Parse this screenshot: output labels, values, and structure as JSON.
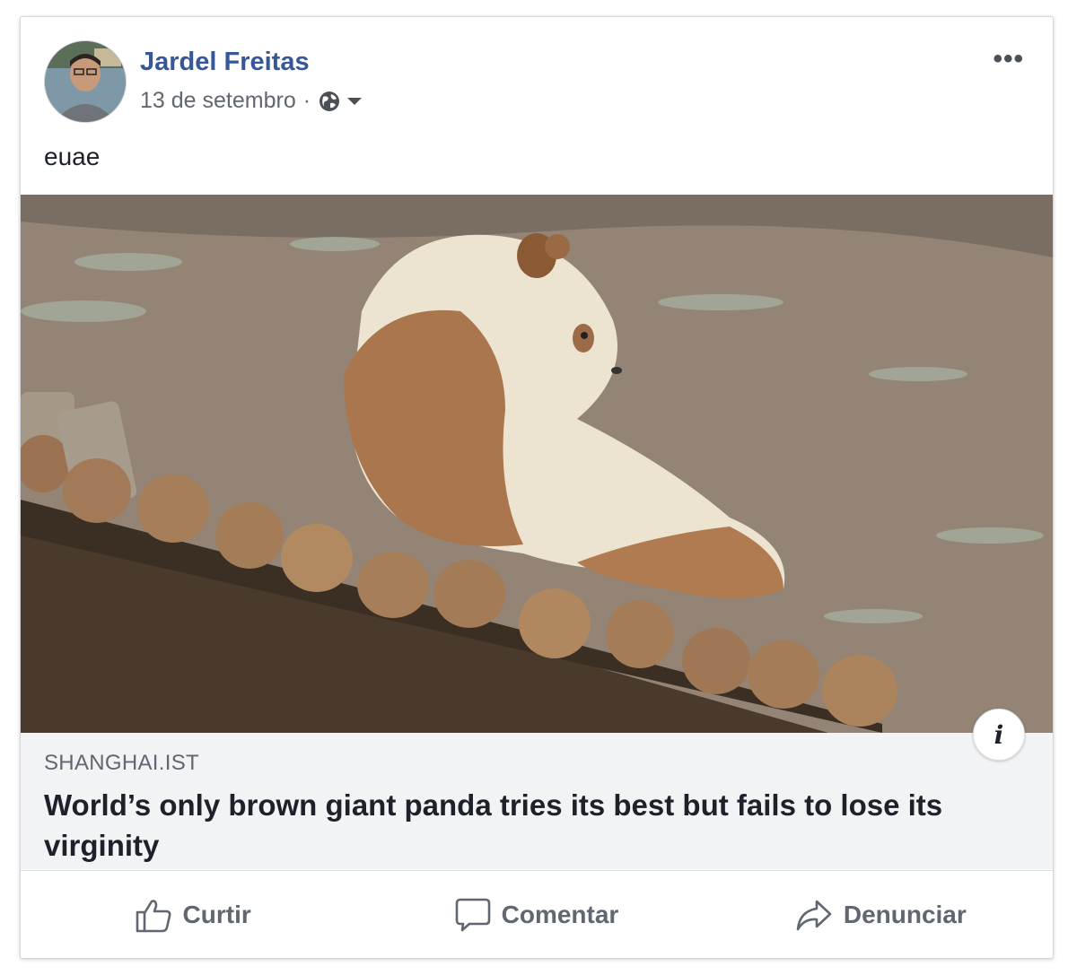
{
  "post": {
    "author": "Jardel Freitas",
    "date": "13 de setembro",
    "separator": "·",
    "privacy_icon": "globe-icon",
    "more_label": "•••",
    "text": "euae"
  },
  "link": {
    "source": "SHANGHAI.IST",
    "headline": "World’s only brown giant panda tries its best but fails to lose its virginity",
    "info_label": "i"
  },
  "actions": [
    {
      "label": "Curtir",
      "icon": "thumbs-up-icon"
    },
    {
      "label": "Comentar",
      "icon": "comment-icon"
    },
    {
      "label": "Denunciar",
      "icon": "share-arrow-icon"
    }
  ],
  "colors": {
    "author_link": "#365899",
    "secondary_text": "#616770",
    "link_box_bg": "#f2f3f5"
  }
}
